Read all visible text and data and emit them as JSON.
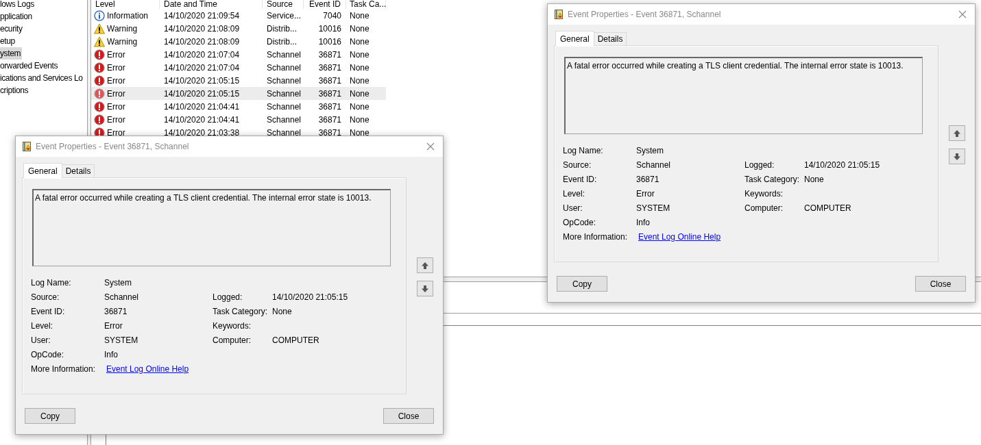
{
  "sidebar": {
    "items": [
      {
        "label": "lows Logs",
        "selected": false
      },
      {
        "label": "pplication",
        "selected": false
      },
      {
        "label": "ecurity",
        "selected": false
      },
      {
        "label": "etup",
        "selected": false
      },
      {
        "label": "ystem",
        "selected": true
      },
      {
        "label": "orwarded Events",
        "selected": false
      },
      {
        "label": "ications and Services Lo",
        "selected": false
      },
      {
        "label": "criptions",
        "selected": false
      }
    ]
  },
  "table": {
    "columns": [
      "Level",
      "Date and Time",
      "Source",
      "Event ID",
      "Task Ca..."
    ],
    "rows": [
      {
        "kind": "information",
        "level": "Information",
        "date": "14/10/2020 21:09:54",
        "source": "Service...",
        "event_id": "7040",
        "task_category": "None",
        "selected": false
      },
      {
        "kind": "warning",
        "level": "Warning",
        "date": "14/10/2020 21:08:09",
        "source": "Distrib...",
        "event_id": "10016",
        "task_category": "None",
        "selected": false
      },
      {
        "kind": "warning",
        "level": "Warning",
        "date": "14/10/2020 21:08:09",
        "source": "Distrib...",
        "event_id": "10016",
        "task_category": "None",
        "selected": false
      },
      {
        "kind": "error",
        "level": "Error",
        "date": "14/10/2020 21:07:04",
        "source": "Schannel",
        "event_id": "36871",
        "task_category": "None",
        "selected": false
      },
      {
        "kind": "error",
        "level": "Error",
        "date": "14/10/2020 21:07:04",
        "source": "Schannel",
        "event_id": "36871",
        "task_category": "None",
        "selected": false
      },
      {
        "kind": "error",
        "level": "Error",
        "date": "14/10/2020 21:05:15",
        "source": "Schannel",
        "event_id": "36871",
        "task_category": "None",
        "selected": false
      },
      {
        "kind": "error",
        "level": "Error",
        "date": "14/10/2020 21:05:15",
        "source": "Schannel",
        "event_id": "36871",
        "task_category": "None",
        "selected": true
      },
      {
        "kind": "error",
        "level": "Error",
        "date": "14/10/2020 21:04:41",
        "source": "Schannel",
        "event_id": "36871",
        "task_category": "None",
        "selected": false
      },
      {
        "kind": "error",
        "level": "Error",
        "date": "14/10/2020 21:04:41",
        "source": "Schannel",
        "event_id": "36871",
        "task_category": "None",
        "selected": false
      },
      {
        "kind": "error",
        "level": "Error",
        "date": "14/10/2020 21:03:38",
        "source": "Schannel",
        "event_id": "36871",
        "task_category": "None",
        "selected": false
      }
    ]
  },
  "dialogs": [
    {
      "title": "Event Properties - Event 36871, Schannel",
      "tabs": [
        {
          "label": "General",
          "selected": true
        },
        {
          "label": "Details",
          "selected": false
        }
      ],
      "message": "A fatal error occurred while creating a TLS client credential. The internal error state is 10013.",
      "left_fields": [
        {
          "label": "Log Name:",
          "value": "System"
        },
        {
          "label": "Source:",
          "value": "Schannel"
        },
        {
          "label": "Event ID:",
          "value": "36871"
        },
        {
          "label": "Level:",
          "value": "Error"
        },
        {
          "label": "User:",
          "value": "SYSTEM"
        },
        {
          "label": "OpCode:",
          "value": "Info"
        },
        {
          "label": "More Information:",
          "link": "Event Log Online Help"
        }
      ],
      "right_fields": [
        {
          "label": "Logged:",
          "value": "14/10/2020 21:05:15"
        },
        {
          "label": "Task Category:",
          "value": "None"
        },
        {
          "label": "Keywords:"
        },
        {
          "label": "Computer:",
          "value": "COMPUTER"
        }
      ],
      "buttons": [
        "Copy",
        "Close"
      ]
    },
    {
      "title": "Event Properties - Event 36871, Schannel",
      "tabs": [
        {
          "label": "General",
          "selected": true
        },
        {
          "label": "Details",
          "selected": false
        }
      ],
      "message": "A fatal error occurred while creating a TLS client credential. The internal error state is 10013.",
      "left_fields": [
        {
          "label": "Log Name:",
          "value": "System"
        },
        {
          "label": "Source:",
          "value": "Schannel"
        },
        {
          "label": "Event ID:",
          "value": "36871"
        },
        {
          "label": "Level:",
          "value": "Error"
        },
        {
          "label": "User:",
          "value": "SYSTEM"
        },
        {
          "label": "OpCode:",
          "value": "Info"
        },
        {
          "label": "More Information:",
          "link": "Event Log Online Help"
        }
      ],
      "right_fields": [
        {
          "label": "Logged:",
          "value": "14/10/2020 21:05:15"
        },
        {
          "label": "Task Category:",
          "value": "None"
        },
        {
          "label": "Keywords:"
        },
        {
          "label": "Computer:",
          "value": "COMPUTER"
        }
      ],
      "buttons": [
        "Copy",
        "Close"
      ]
    }
  ]
}
